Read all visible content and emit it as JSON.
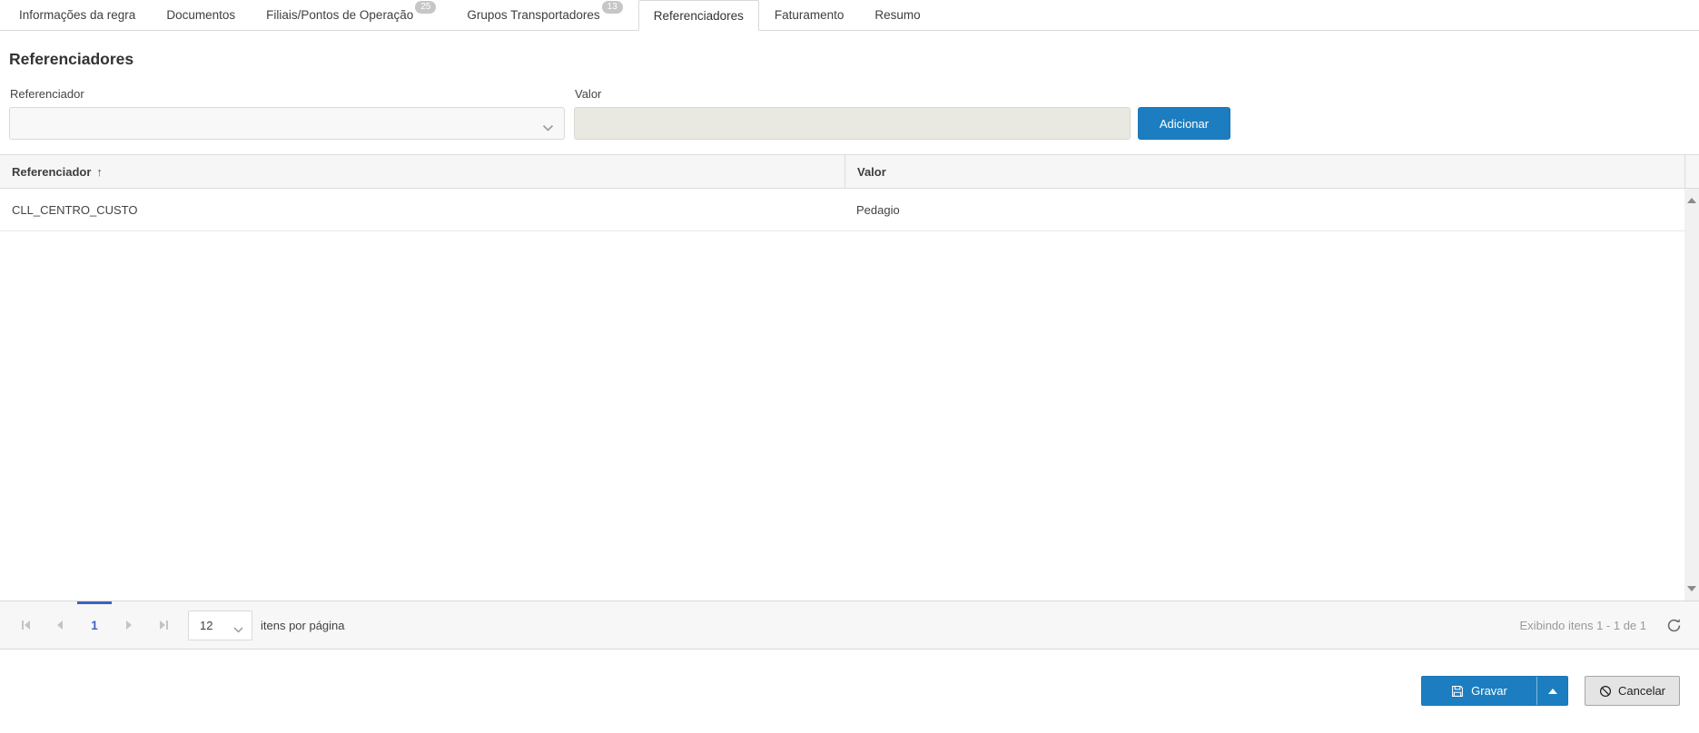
{
  "tabs": [
    {
      "label": "Informações da regra",
      "active": false
    },
    {
      "label": "Documentos",
      "active": false
    },
    {
      "label": "Filiais/Pontos de Operação",
      "badge": "25",
      "active": false
    },
    {
      "label": "Grupos Transportadores",
      "badge": "13",
      "active": false
    },
    {
      "label": "Referenciadores",
      "active": true
    },
    {
      "label": "Faturamento",
      "active": false
    },
    {
      "label": "Resumo",
      "active": false
    }
  ],
  "section": {
    "title": "Referenciadores"
  },
  "form": {
    "referenciador": {
      "label": "Referenciador",
      "value": ""
    },
    "valor": {
      "label": "Valor",
      "value": ""
    },
    "add_button_label": "Adicionar"
  },
  "table": {
    "columns": [
      {
        "label": "Referenciador",
        "sorted": "asc"
      },
      {
        "label": "Valor"
      }
    ],
    "rows": [
      {
        "referenciador": "CLL_CENTRO_CUSTO",
        "valor": "Pedagio"
      }
    ]
  },
  "pager": {
    "current_page": "1",
    "page_size": "12",
    "items_per_page_label": "itens por página",
    "info": "Exibindo itens 1 - 1 de 1"
  },
  "footer": {
    "save_label": "Gravar",
    "cancel_label": "Cancelar"
  },
  "icons": {
    "sort_asc": "↑"
  },
  "colors": {
    "primary_button": "#1c7ec0",
    "pager_accent": "#3e62c4",
    "valor_input_bg": "#e9e9e1",
    "badge_bg": "#c6c6c6"
  }
}
